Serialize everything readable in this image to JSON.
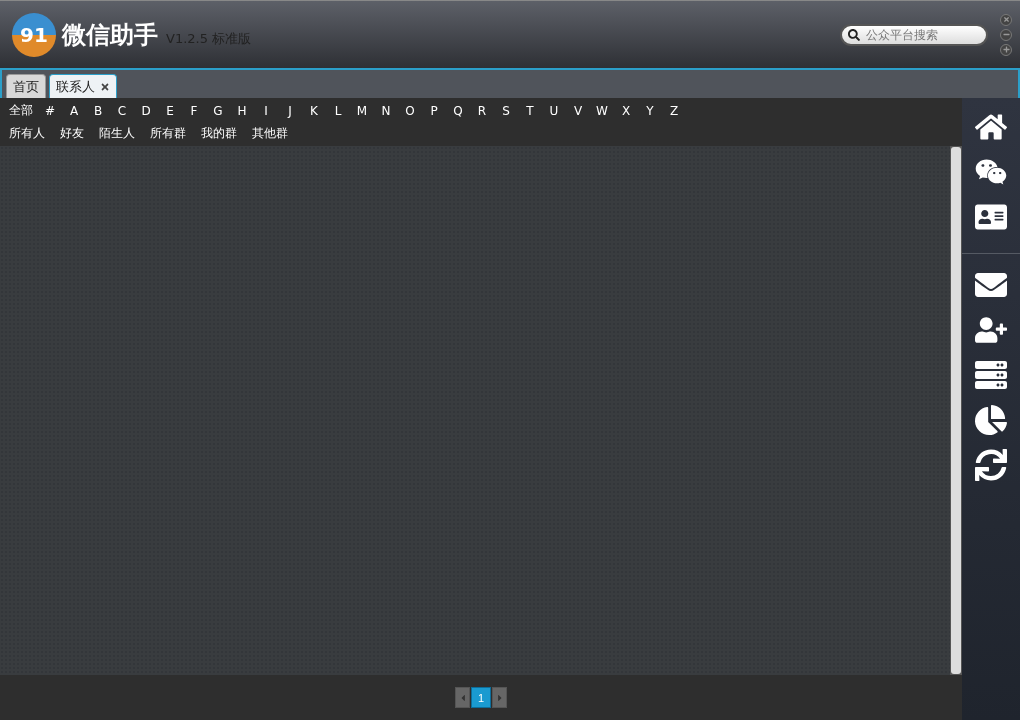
{
  "window": {
    "logo_text": "91",
    "title": "微信助手",
    "version": "V1.2.5 标准版"
  },
  "search": {
    "placeholder": "公众平台搜索"
  },
  "tabs": [
    {
      "label": "首页",
      "selected": false,
      "closable": false
    },
    {
      "label": "联系人",
      "selected": true,
      "closable": true
    }
  ],
  "letters": [
    "全部",
    "#",
    "A",
    "B",
    "C",
    "D",
    "E",
    "F",
    "G",
    "H",
    "I",
    "J",
    "K",
    "L",
    "M",
    "N",
    "O",
    "P",
    "Q",
    "R",
    "S",
    "T",
    "U",
    "V",
    "W",
    "X",
    "Y",
    "Z"
  ],
  "filters": [
    "所有人",
    "好友",
    "陌生人",
    "所有群",
    "我的群",
    "其他群"
  ],
  "pager": {
    "pages": [
      {
        "label": "1",
        "selected": true
      }
    ]
  }
}
